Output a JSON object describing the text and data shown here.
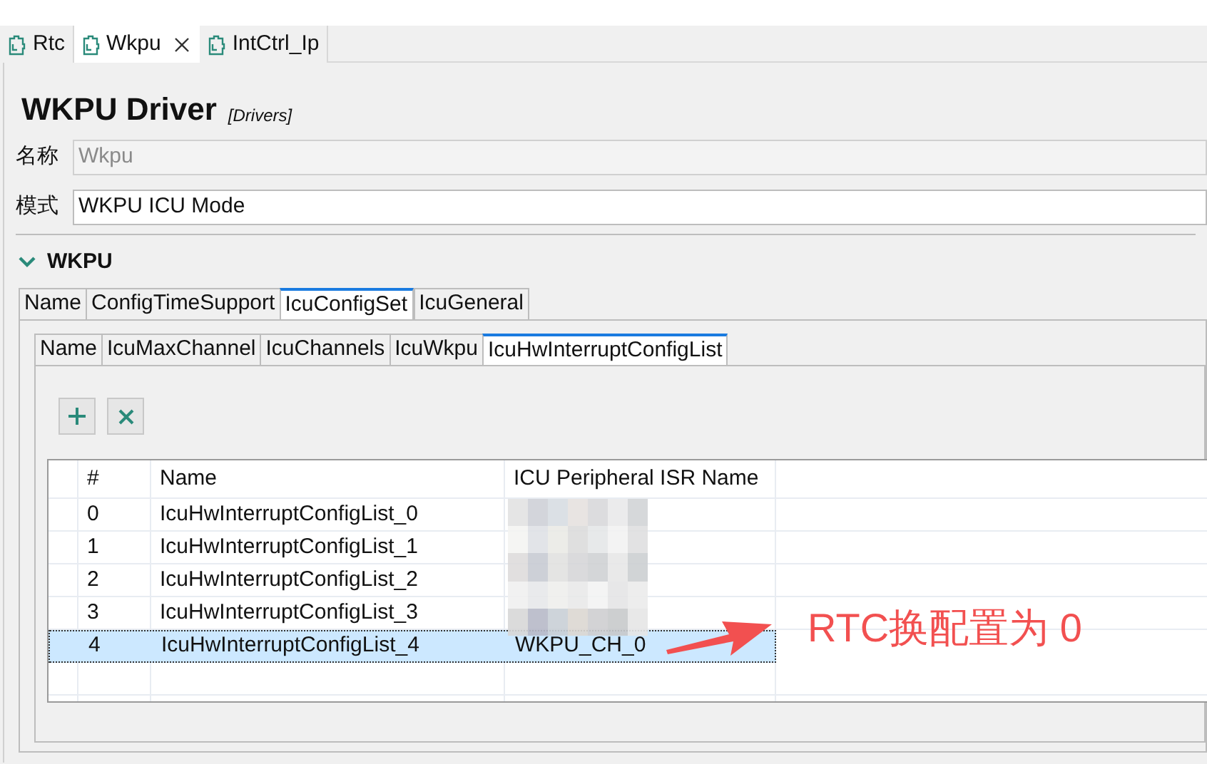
{
  "editor_tabs": [
    {
      "label": "Rtc",
      "selected": false,
      "closable": false
    },
    {
      "label": "Wkpu",
      "selected": true,
      "closable": true
    },
    {
      "label": "IntCtrl_Ip",
      "selected": false,
      "closable": false
    }
  ],
  "title": "WKPU Driver",
  "subtitle": "[Drivers]",
  "fields": [
    {
      "label": "名称",
      "value": "Wkpu",
      "disabled": true
    },
    {
      "label": "模式",
      "value": "WKPU ICU Mode",
      "disabled": false
    }
  ],
  "section": {
    "title": "WKPU",
    "expanded": true
  },
  "outer_tabs": [
    {
      "label": "Name",
      "selected": false
    },
    {
      "label": "ConfigTimeSupport",
      "selected": false
    },
    {
      "label": "IcuConfigSet",
      "selected": true
    },
    {
      "label": "IcuGeneral",
      "selected": false
    }
  ],
  "inner_tabs": [
    {
      "label": "Name",
      "selected": false
    },
    {
      "label": "IcuMaxChannel",
      "selected": false
    },
    {
      "label": "IcuChannels",
      "selected": false
    },
    {
      "label": "IcuWkpu",
      "selected": false
    },
    {
      "label": "IcuHwInterruptConfigList",
      "selected": true
    }
  ],
  "table": {
    "columns": [
      "#",
      "Name",
      "ICU Peripheral ISR Name"
    ],
    "rows": [
      {
        "cells": [
          "0",
          "IcuHwInterruptConfigList_0"
        ],
        "selected": false
      },
      {
        "cells": [
          "1",
          "IcuHwInterruptConfigList_1"
        ],
        "selected": false
      },
      {
        "cells": [
          "2",
          "IcuHwInterruptConfigList_2"
        ],
        "selected": false
      },
      {
        "cells": [
          "3",
          "IcuHwInterruptConfigList_3"
        ],
        "selected": false
      },
      {
        "cells": [
          "4",
          "IcuHwInterruptConfigList_4",
          "WKPU_CH_0"
        ],
        "selected": true
      }
    ]
  },
  "annotation": "RTC换配置为 0"
}
